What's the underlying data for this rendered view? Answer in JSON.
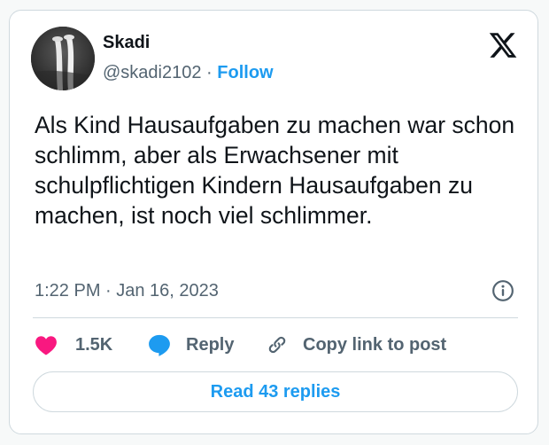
{
  "author": {
    "name": "Skadi",
    "handle": "@skadi2102",
    "separator": "·",
    "follow_label": "Follow"
  },
  "platform_icon": "x-logo-icon",
  "tweet": {
    "text": "Als Kind Hausaufgaben zu machen war schon schlimm, aber als Erwachsener mit schulpflichtigen Kindern Hausaufgaben zu machen, ist noch viel schlimmer.",
    "timestamp": "1:22 PM · Jan 16, 2023"
  },
  "actions": {
    "like_count": "1.5K",
    "reply_label": "Reply",
    "copy_label": "Copy link to post"
  },
  "read_replies_label": "Read 43 replies",
  "colors": {
    "accent": "#1d9bf0",
    "like": "#f91880",
    "muted_text": "#536471",
    "border": "#cfd9de"
  }
}
